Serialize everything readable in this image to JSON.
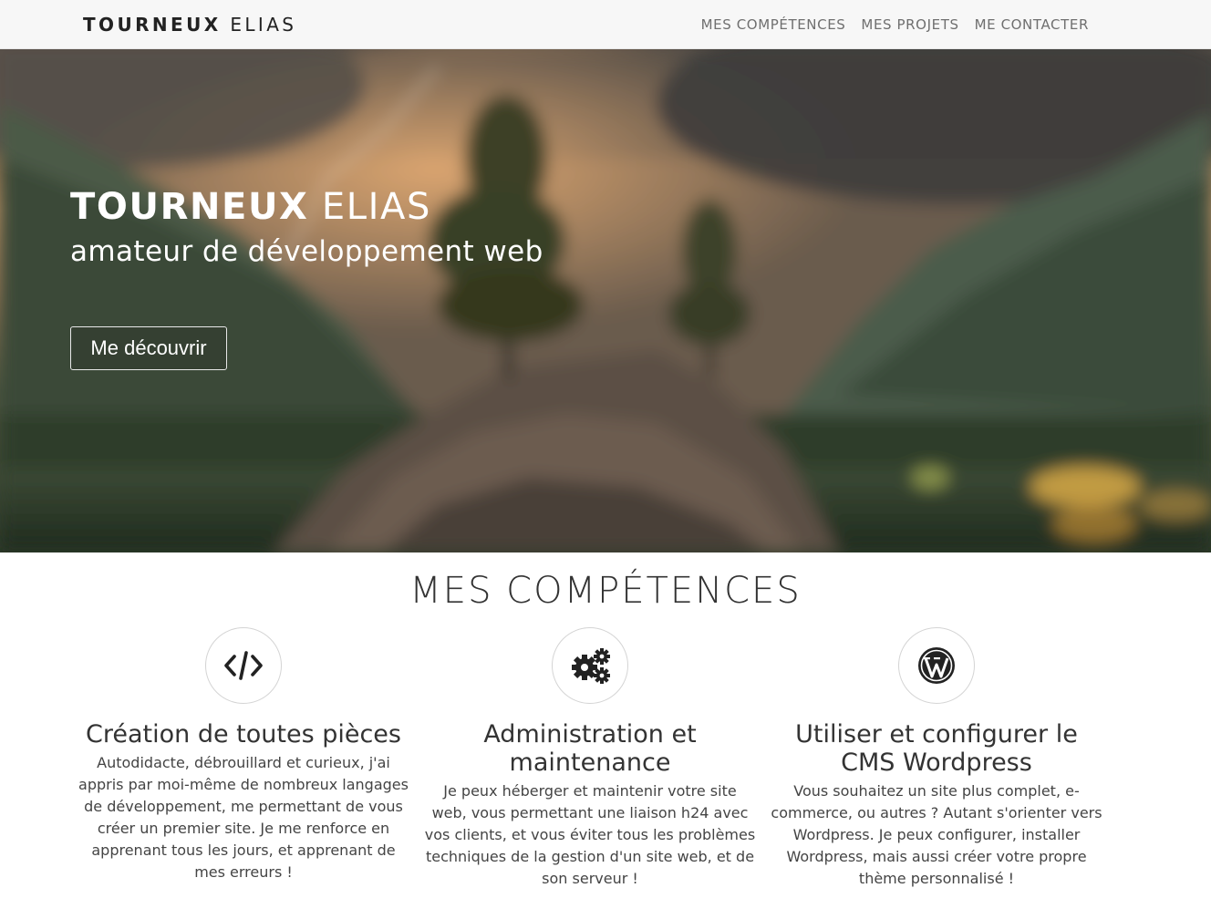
{
  "navbar": {
    "brand_bold": "TOURNEUX",
    "brand_light": "ELIAS",
    "links": [
      "MES COMPÉTENCES",
      "MES PROJETS",
      "ME CONTACTER"
    ]
  },
  "hero": {
    "title_bold": "TOURNEUX",
    "title_light": "ELIAS",
    "subtitle": "amateur de développement web",
    "button_label": "Me découvrir"
  },
  "skills": {
    "title": "MES COMPÉTENCES",
    "items": [
      {
        "icon": "code-icon",
        "heading": "Création de toutes pièces",
        "text": "Autodidacte, débrouillard et curieux, j'ai appris par moi-même de nombreux langages de développement, me permettant de vous créer un premier site. Je me renforce en apprenant tous les jours, et apprenant de mes erreurs !"
      },
      {
        "icon": "gears-icon",
        "heading": "Administration et maintenance",
        "text": "Je peux héberger et maintenir votre site web, vous permettant une liaison h24 avec vos clients, et vous éviter tous les problèmes techniques de la gestion d'un site web, et de son serveur !"
      },
      {
        "icon": "wordpress-icon",
        "heading": "Utiliser et configurer le CMS Wordpress",
        "text": "Vous souhaitez un site plus complet, e-commerce, ou autres ? Autant s'orienter vers Wordpress. Je peux configurer, installer Wordpress, mais aussi créer votre propre thème personnalisé !"
      }
    ]
  },
  "colors": {
    "navbar_bg": "#f7f7f7",
    "nav_link": "#6f6f6f",
    "text_dark": "#333333"
  }
}
